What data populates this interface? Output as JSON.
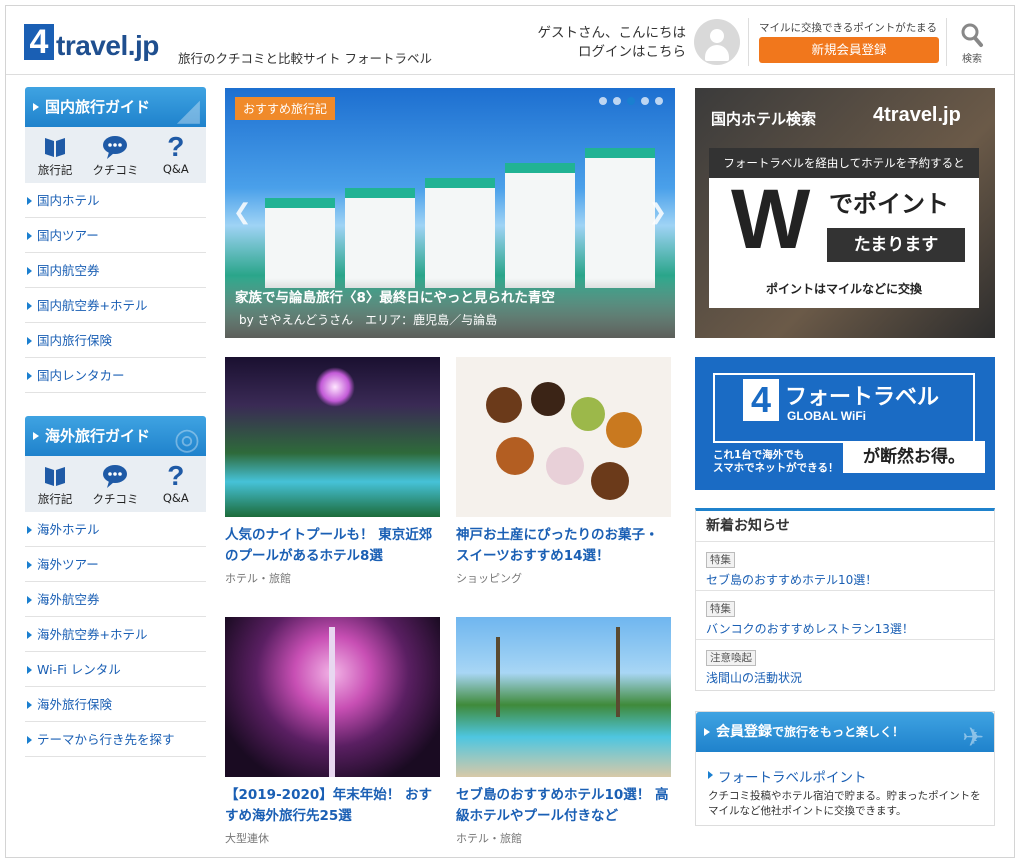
{
  "header": {
    "logo_mark": "4",
    "logo_text": "travel.jp",
    "tagline": "旅行のクチコミと比較サイト フォートラベル",
    "greeting": "ゲストさん、こんにちは",
    "login": "ログインはこちら",
    "register_note": "マイルに交換できるポイントがたまる",
    "register_button": "新規会員登録",
    "search_label": "検索"
  },
  "domestic": {
    "title": "国内旅行ガイド",
    "icons": [
      {
        "label": "旅行記",
        "icon": "book-icon"
      },
      {
        "label": "クチコミ",
        "icon": "speech-bubble-icon"
      },
      {
        "label": "Q&A",
        "icon": "question-icon"
      }
    ],
    "links": [
      "国内ホテル",
      "国内ツアー",
      "国内航空券",
      "国内航空券+ホテル",
      "国内旅行保険",
      "国内レンタカー"
    ]
  },
  "overseas": {
    "title": "海外旅行ガイド",
    "icons": [
      {
        "label": "旅行記",
        "icon": "book-icon"
      },
      {
        "label": "クチコミ",
        "icon": "speech-bubble-icon"
      },
      {
        "label": "Q&A",
        "icon": "question-icon"
      }
    ],
    "links": [
      "海外ホテル",
      "海外ツアー",
      "海外航空券",
      "海外航空券+ホテル",
      "Wi-Fi レンタル",
      "海外旅行保険",
      "テーマから行き先を探す"
    ]
  },
  "hero": {
    "tag": "おすすめ旅行記",
    "title": "家族で与論島旅行〈8〉最終日にやっと見られた青空",
    "byline": "by さやえんどうさん　エリア：鹿児島／与論島",
    "slide_count": 5,
    "active_slide": 3
  },
  "cards": [
    {
      "title": "人気のナイトプールも！ 東京近郊のプールがあるホテル8選",
      "category": "ホテル・旅館"
    },
    {
      "title": "神戸お土産にぴったりのお菓子・スイーツおすすめ14選！",
      "category": "ショッピング"
    },
    {
      "title": "【2019-2020】年末年始！ おすすめ海外旅行先25選",
      "category": "大型連休"
    },
    {
      "title": "セブ島のおすすめホテル10選！ 高級ホテルやプール付きなど",
      "category": "ホテル・旅館"
    }
  ],
  "hotel_ad": {
    "heading": "国内ホテル検索",
    "logo": "4travel.jp",
    "strip": "フォートラベルを経由してホテルを予約すると",
    "big": "W",
    "points": "でポイント",
    "accrue": "たまります",
    "sub": "ポイントはマイルなどに交換"
  },
  "wifi_ad": {
    "mark": "4",
    "brand": "フォートラベル",
    "product": "GLOBAL WiFi",
    "line1": "これ1台で海外でも",
    "line2": "スマホでネットができる！",
    "badge": "が断然お得。"
  },
  "news": {
    "heading": "新着お知らせ",
    "items": [
      {
        "tag": "特集",
        "text": "セブ島のおすすめホテル10選！"
      },
      {
        "tag": "特集",
        "text": "バンコクのおすすめレストラン13選！"
      },
      {
        "tag": "注意喚起",
        "text": "浅間山の活動状況"
      }
    ]
  },
  "member": {
    "heading_main": "会員登録",
    "heading_rest": "で旅行をもっと楽しく！",
    "link": "フォートラベルポイント",
    "desc": "クチコミ投稿やホテル宿泊で貯まる。貯まったポイントをマイルなど他社ポイントに交換できます。"
  },
  "colors": {
    "accent_blue": "#1f82cc",
    "link_blue": "#1a5fb4",
    "orange": "#f1771c"
  }
}
